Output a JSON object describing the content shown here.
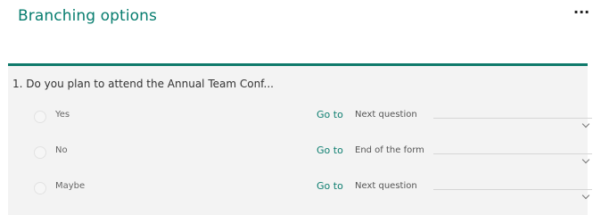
{
  "header": {
    "title": "Branching options",
    "more_label": "···"
  },
  "question": {
    "text": "1. Do you plan to attend the Annual Team Conf..."
  },
  "options": [
    {
      "label": "Yes",
      "goto": "Go to",
      "destination": "Next question"
    },
    {
      "label": "No",
      "goto": "Go to",
      "destination": "End of the form"
    },
    {
      "label": "Maybe",
      "goto": "Go to",
      "destination": "Next question"
    }
  ],
  "colors": {
    "accent": "#0f7a6b",
    "title": "#077d6f",
    "panel": "#f3f3f3"
  }
}
